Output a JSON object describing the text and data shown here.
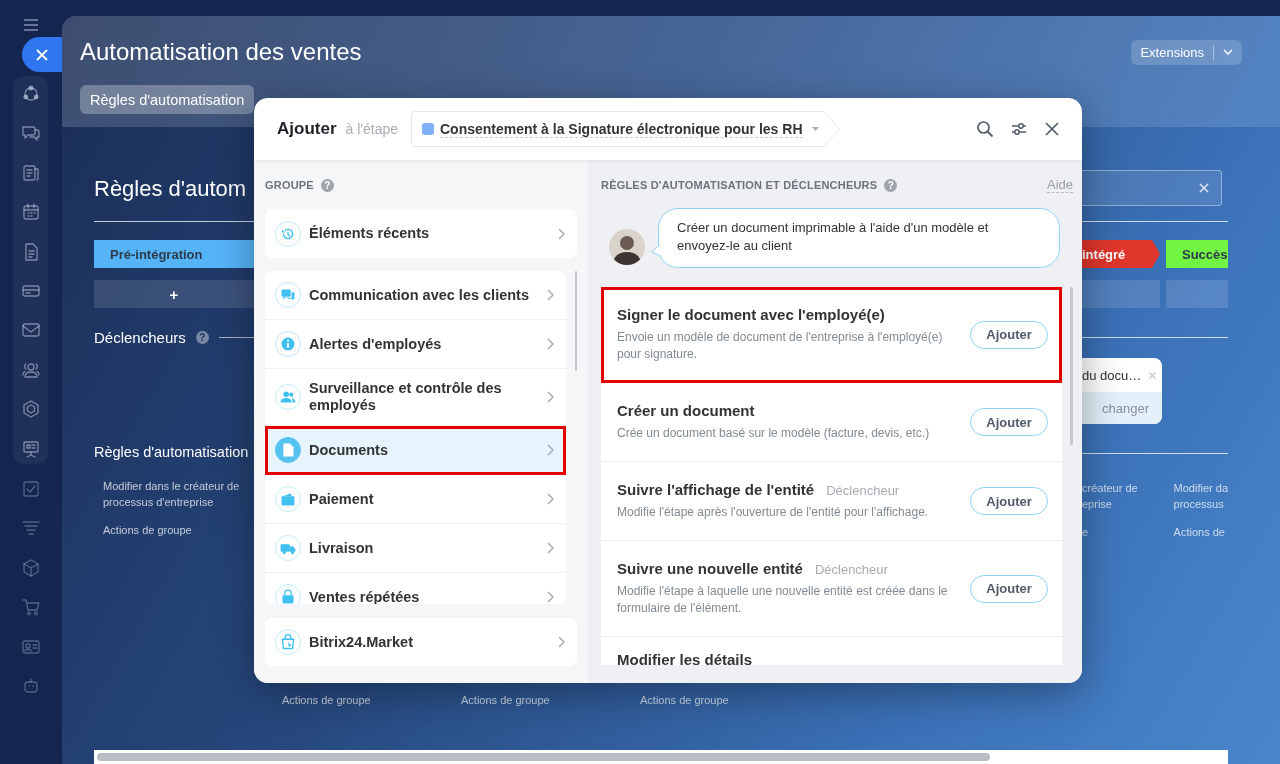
{
  "page": {
    "title": "Automatisation des ventes",
    "extensions": "Extensions",
    "tabs": [
      {
        "label": "Règles d'automatisation",
        "selected": true
      }
    ]
  },
  "board": {
    "heading": "Règles d'autom",
    "stages": [
      {
        "label": "Pré-intégration",
        "color": "#55b4f8"
      },
      {
        "label": "intégré",
        "color": "#e0362b"
      },
      {
        "label": "Succès",
        "color": "#72f542"
      }
    ],
    "add_stage": "+",
    "triggers_title": "Déclencheurs",
    "triggers_help": "?",
    "trigger_card": {
      "title": "du docu…",
      "action": "changer"
    },
    "rules_title": "Règles d'automatisation",
    "columns_left": [
      {
        "edit": "Modifier dans le créateur de\nprocessus d'entreprise",
        "group": "Actions de groupe"
      }
    ],
    "group_actions_below": [
      "Actions de groupe",
      "Actions de groupe",
      "Actions de groupe"
    ],
    "columns_right": [
      {
        "edit": "créateur de\neprise",
        "group": "e"
      },
      {
        "edit": "Modifier da\nprocessus",
        "group": "Actions de"
      }
    ]
  },
  "dialog": {
    "title": "Ajouter",
    "stage_prefix": "à l'étape",
    "stage": {
      "label": "Consentement à la Signature électronique pour les RH",
      "color": "#7fb0f5"
    },
    "groups_title": "GROUPE",
    "groups_help": "?",
    "recent": "Éléments récents",
    "groups": [
      {
        "label": "Communication avec les clients",
        "selected": false,
        "highlighted": false
      },
      {
        "label": "Alertes d'employés",
        "selected": false,
        "highlighted": false
      },
      {
        "label": "Surveillance et contrôle des employés",
        "selected": false,
        "highlighted": false
      },
      {
        "label": "Documents",
        "selected": true,
        "highlighted": true
      },
      {
        "label": "Paiement",
        "selected": false,
        "highlighted": false
      },
      {
        "label": "Livraison",
        "selected": false,
        "highlighted": false
      },
      {
        "label": "Ventes répétées",
        "selected": false,
        "highlighted": false
      }
    ],
    "market": "Bitrix24.Market",
    "rules_title": "RÈGLES D'AUTOMATISATION ET DÉCLENCHEURS",
    "rules_help": "?",
    "help_link": "Aide",
    "hint": "Créer un document imprimable à l'aide d'un modèle et envoyez-le au client",
    "rules": [
      {
        "title": "Signer le document avec l'employé(e)",
        "description": "Envoie un modèle de document de l'entreprise à l'employé(e) pour signature.",
        "button": "Ajouter",
        "highlighted": true
      },
      {
        "title": "Créer un document",
        "description": "Crée un document basé sur le modèle (facture, devis, etc.)",
        "button": "Ajouter",
        "highlighted": false
      },
      {
        "title": "Suivre l'affichage de l'entité",
        "tag": "Déclencheur",
        "description": "Modifie l'étape après l'ouverture de l'entité pour l'affichage.",
        "button": "Ajouter",
        "highlighted": false
      },
      {
        "title": "Suivre une nouvelle entité",
        "tag": "Déclencheur",
        "description": "Modifie l'étape à laquelle une nouvelle entité est créée dans le formulaire de l'élément.",
        "button": "Ajouter",
        "highlighted": false
      },
      {
        "title": "Modifier les détails",
        "highlighted": false
      }
    ]
  }
}
